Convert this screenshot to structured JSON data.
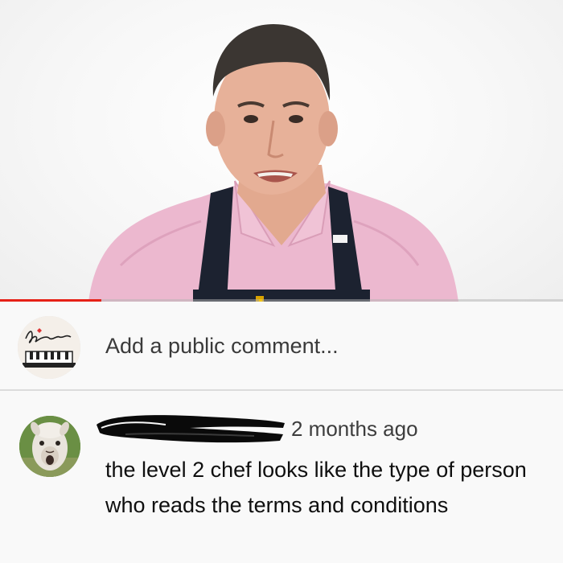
{
  "video": {
    "progress": 0.18,
    "marker": 0.46,
    "colors": {
      "played": "#e62117",
      "marker": "#f2c318"
    }
  },
  "add_comment": {
    "avatar_icon": "signature-logo-avatar",
    "placeholder": "Add a public comment..."
  },
  "comment": {
    "avatar_icon": "alpaca-avatar",
    "author_redacted": true,
    "timestamp": "2 months ago",
    "text": "the level 2 chef looks like the type of person who reads the terms and conditions"
  }
}
